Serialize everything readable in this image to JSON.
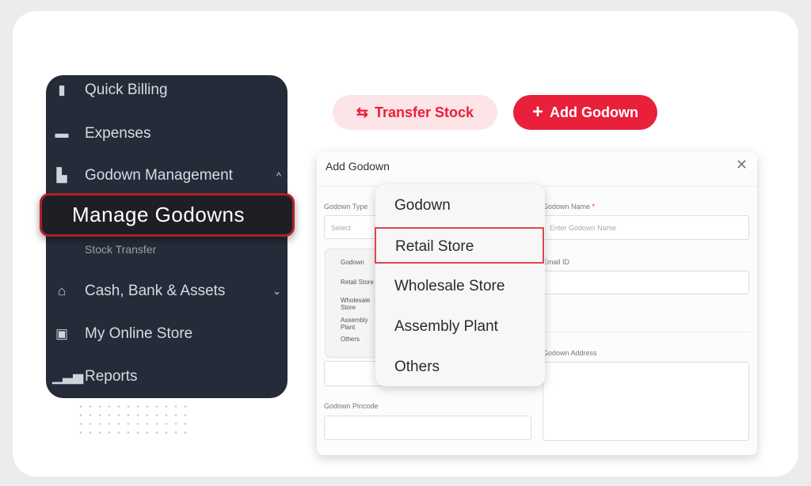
{
  "sidebar": {
    "items": [
      {
        "label": "Quick Billing",
        "icon": "phone-icon"
      },
      {
        "label": "Expenses",
        "icon": "wallet-icon"
      },
      {
        "label": "Godown Management",
        "icon": "boxes-icon",
        "expanded": true
      },
      {
        "label": "Cash, Bank & Assets",
        "icon": "bank-icon",
        "expanded": false
      },
      {
        "label": "My Online Store",
        "icon": "store-icon"
      },
      {
        "label": "Reports",
        "icon": "bar-chart-icon"
      }
    ],
    "sub_items": [
      "Manage Godowns",
      "Stock Transfer"
    ]
  },
  "toolbar": {
    "transfer_label": "Transfer Stock",
    "add_label": "Add Godown"
  },
  "colors": {
    "accent": "#e8203a",
    "sidebar_bg": "#252b38"
  },
  "modal": {
    "title": "Add Godown",
    "godown_type_label": "Godown Type",
    "godown_type_placeholder": "Select",
    "type_list": [
      "Godown",
      "Retail Store",
      "Wholesale Store",
      "Assembly Plant",
      "Others"
    ],
    "godown_name_label": "Godown Name",
    "required_mark": "*",
    "godown_name_placeholder": "Enter Godown Name",
    "email_label": "Email ID",
    "address_label": "Godown Address",
    "pincode_label": "Godown Pincode"
  },
  "dropdown": {
    "options": [
      "Godown",
      "Retail Store",
      "Wholesale Store",
      "Assembly Plant",
      "Others"
    ],
    "selected": "Retail Store"
  }
}
